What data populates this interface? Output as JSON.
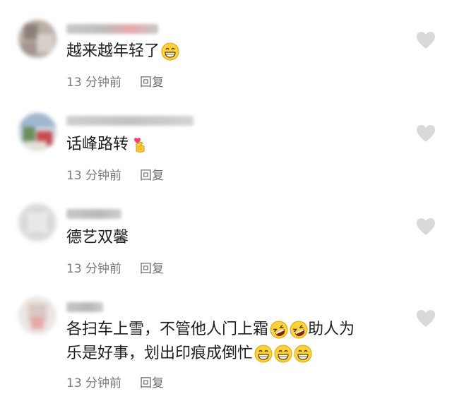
{
  "comments": [
    {
      "text": "越来越年轻了",
      "emojis": [
        "grin-emoji"
      ],
      "time": "13 分钟前",
      "reply_label": "回复"
    },
    {
      "text": "话峰路转",
      "emojis": [
        "finger-heart-emoji"
      ],
      "time": "13 分钟前",
      "reply_label": "回复"
    },
    {
      "text": "德艺双馨",
      "emojis": [],
      "time": "13 分钟前",
      "reply_label": "回复"
    },
    {
      "line1": "各扫车上雪，不管他人门上霜",
      "line1_after_emoji": "助人为",
      "line2": "乐是好事，划出印痕成倒忙",
      "emojis_line1": [
        "rofl-emoji",
        "rofl-emoji"
      ],
      "emojis_line2": [
        "grin-emoji",
        "grin-emoji",
        "grin-emoji"
      ],
      "time": "13 分钟前",
      "reply_label": "回复"
    }
  ],
  "colors": {
    "text": "#1e1e1e",
    "meta": "#7a7a7a",
    "heart": "#d9d9d9",
    "emoji_face": "#ffd23a",
    "emoji_outline": "#e0a400"
  }
}
